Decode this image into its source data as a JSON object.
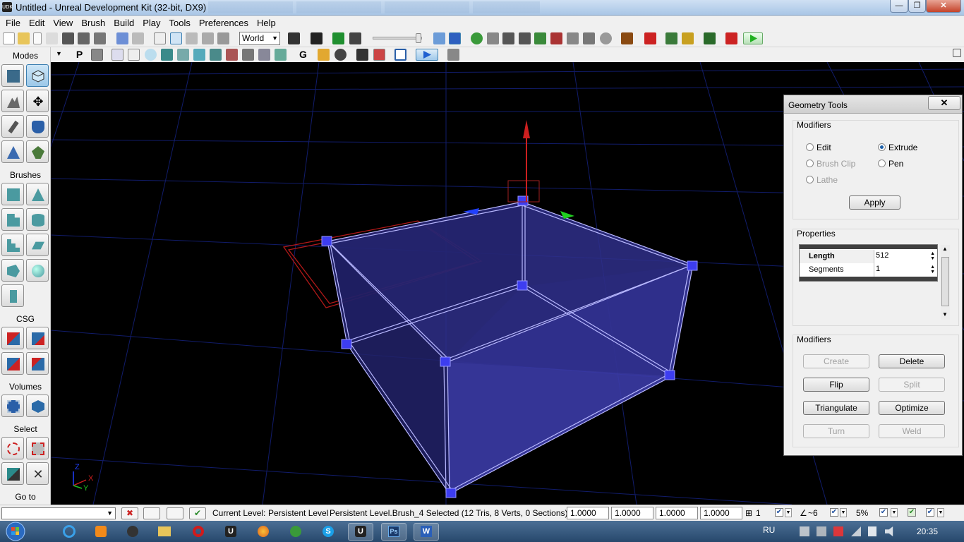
{
  "window": {
    "title": "Untitled - Unreal Development Kit (32-bit, DX9)",
    "app_icon_text": "UDK",
    "minimize": "—",
    "maximize": "❐",
    "close": "✕"
  },
  "menu": [
    "File",
    "Edit",
    "View",
    "Brush",
    "Build",
    "Play",
    "Tools",
    "Preferences",
    "Help"
  ],
  "toolbar": {
    "coordinate_system": "World"
  },
  "modes_panel": {
    "header": "Modes",
    "toolbar_letter": "P",
    "sections": {
      "brushes": "Brushes",
      "csg": "CSG",
      "volumes": "Volumes",
      "select": "Select",
      "goto": "Go to"
    }
  },
  "viewport": {
    "axis_labels": {
      "x": "X",
      "y": "Y",
      "z": "Z"
    },
    "selection_colors": {
      "brush": "#5a5aff",
      "builder": "#cc1f1f",
      "translate_x": "#cc1f1f",
      "translate_y": "#20d020",
      "translate_z": "#2040ff"
    }
  },
  "geometry_tools": {
    "title": "Geometry Tools",
    "close": "✕",
    "modifiers_label": "Modifiers",
    "radio_options": [
      {
        "label": "Edit",
        "selected": false,
        "enabled": true
      },
      {
        "label": "Extrude",
        "selected": true,
        "enabled": true
      },
      {
        "label": "Brush Clip",
        "selected": false,
        "enabled": false
      },
      {
        "label": "Pen",
        "selected": false,
        "enabled": true
      },
      {
        "label": "Lathe",
        "selected": false,
        "enabled": false
      }
    ],
    "apply": "Apply",
    "properties_label": "Properties",
    "properties": [
      {
        "name": "Length",
        "value": "512"
      },
      {
        "name": "Segments",
        "value": "1"
      }
    ],
    "modifiers2_label": "Modifiers",
    "buttons": [
      {
        "label": "Create",
        "enabled": false
      },
      {
        "label": "Delete",
        "enabled": true
      },
      {
        "label": "Flip",
        "enabled": true
      },
      {
        "label": "Split",
        "enabled": false
      },
      {
        "label": "Triangulate",
        "enabled": true
      },
      {
        "label": "Optimize",
        "enabled": true
      },
      {
        "label": "Turn",
        "enabled": false
      },
      {
        "label": "Weld",
        "enabled": false
      }
    ]
  },
  "statusbar": {
    "current_level_label": "Current Level:",
    "current_level": "Persistent Level",
    "selection": "Persistent Level.Brush_4 Selected (12 Tris, 8 Verts, 0 Sections)",
    "scales": [
      "1.0000",
      "1.0000",
      "1.0000",
      "1.0000"
    ],
    "grid_value": "1",
    "rotation_snap": "~6",
    "scale_snap": "5%"
  },
  "taskbar": {
    "language": "RU",
    "time": "20:35"
  }
}
